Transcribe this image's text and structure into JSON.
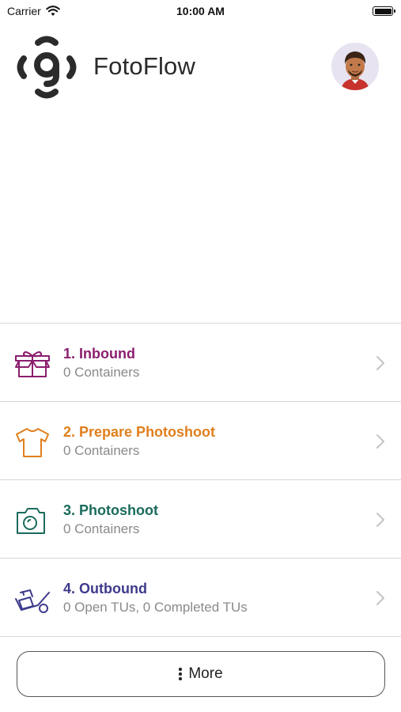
{
  "status_bar": {
    "carrier": "Carrier",
    "time": "10:00 AM"
  },
  "header": {
    "app_name": "FotoFlow"
  },
  "colors": {
    "inbound": "#8b1e6e",
    "prepare": "#e07f1c",
    "photoshoot": "#1a6b5c",
    "outbound": "#3e3a8c"
  },
  "steps": [
    {
      "title": "1. Inbound",
      "subtitle": "0 Containers",
      "icon": "gift-box-icon"
    },
    {
      "title": "2. Prepare Photoshoot",
      "subtitle": "0 Containers",
      "icon": "t-shirt-icon"
    },
    {
      "title": "3. Photoshoot",
      "subtitle": "0 Containers",
      "icon": "camera-icon"
    },
    {
      "title": "4. Outbound",
      "subtitle": "0 Open TUs, 0 Completed TUs",
      "icon": "hand-truck-icon"
    }
  ],
  "footer": {
    "more_label": "More"
  }
}
